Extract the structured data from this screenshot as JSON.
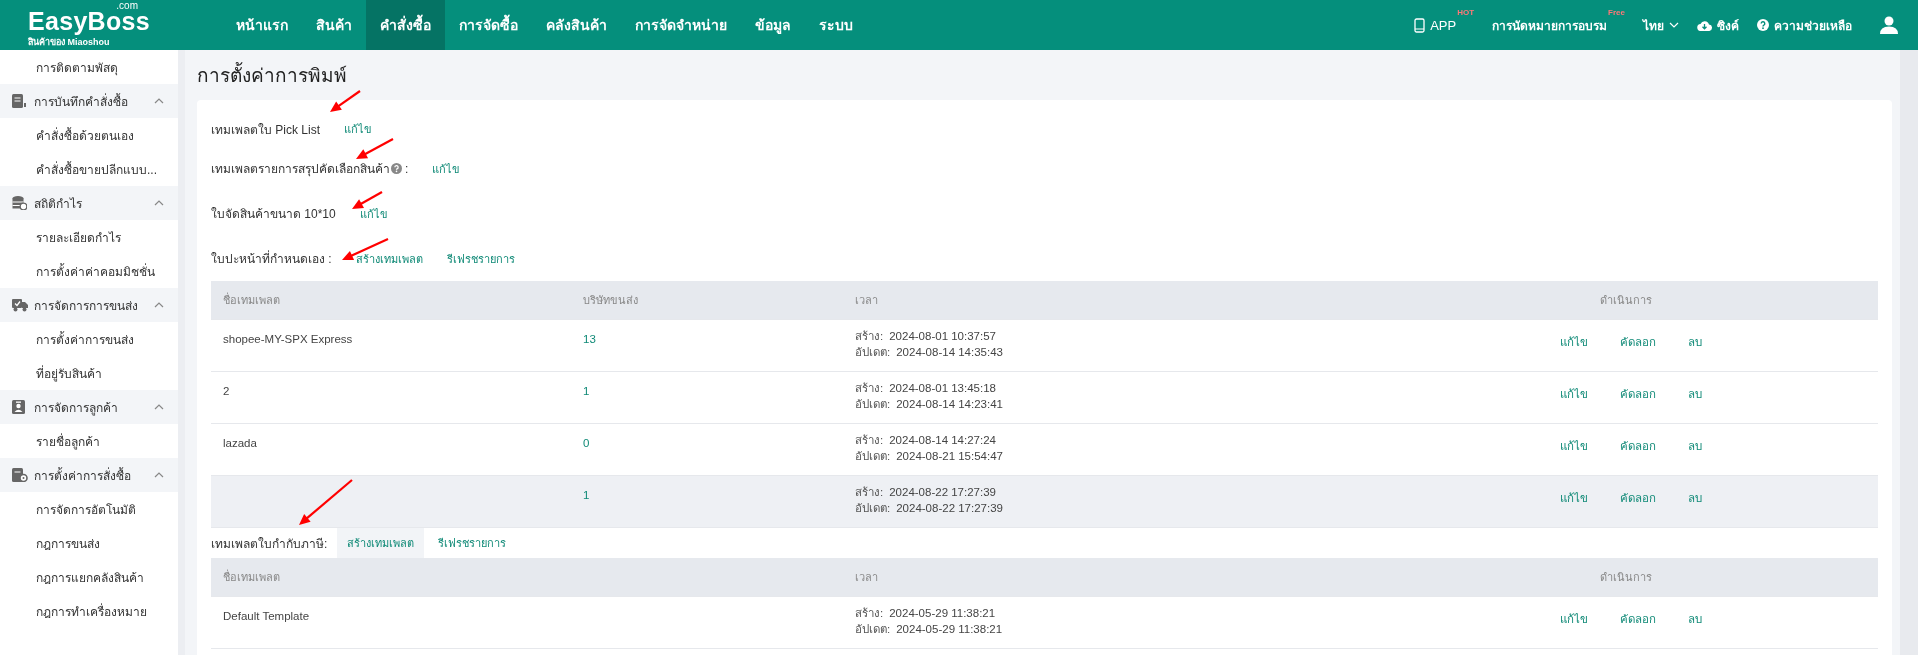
{
  "header": {
    "logo": {
      "name": "EasyBoss",
      "domain": ".com",
      "tagline": "สินค้าของ Miaoshou"
    },
    "nav": [
      {
        "label": "หน้าแรก",
        "selected": false
      },
      {
        "label": "สินค้า",
        "selected": false
      },
      {
        "label": "คำสั่งซื้อ",
        "selected": true
      },
      {
        "label": "การจัดซื้อ",
        "selected": false
      },
      {
        "label": "คลังสินค้า",
        "selected": false
      },
      {
        "label": "การจัดจำหน่าย",
        "selected": false
      },
      {
        "label": "ข้อมูล",
        "selected": false
      },
      {
        "label": "ระบบ",
        "selected": false
      }
    ],
    "app": {
      "label": "APP",
      "badge": "HOT"
    },
    "training": {
      "label": "การนัดหมายการอบรม",
      "badge": "Free"
    },
    "language": "ไทย",
    "sync": "ซิงค์",
    "help": "ความช่วยเหลือ"
  },
  "sidebar": {
    "items": [
      {
        "label": "การติดตามพัสดุ"
      }
    ],
    "groups": [
      {
        "label": "การบันทึกคำสั่งซื้อ",
        "expanded": true,
        "children": [
          {
            "label": "คำสั่งซื้อด้วยตนเอง"
          },
          {
            "label": "คำสั่งซื้อขายปลีกแบบ..."
          }
        ]
      },
      {
        "label": "สถิติกำไร",
        "expanded": true,
        "children": [
          {
            "label": "รายละเอียดกำไร"
          },
          {
            "label": "การตั้งค่าค่าคอมมิชชั่น"
          }
        ]
      },
      {
        "label": "การจัดการการขนส่ง",
        "expanded": true,
        "children": [
          {
            "label": "การตั้งค่าการขนส่ง"
          },
          {
            "label": "ที่อยู่รับสินค้า"
          }
        ]
      },
      {
        "label": "การจัดการลูกค้า",
        "expanded": true,
        "children": [
          {
            "label": "รายชื่อลูกค้า"
          }
        ]
      },
      {
        "label": "การตั้งค่าการสั่งซื้อ",
        "expanded": true,
        "children": [
          {
            "label": "การจัดการอัตโนมัติ"
          },
          {
            "label": "กฎการขนส่ง"
          },
          {
            "label": "กฎการแยกคลังสินค้า"
          },
          {
            "label": "กฎการทำเครื่องหมาย"
          }
        ]
      }
    ]
  },
  "page_title": "การตั้งค่าการพิมพ์",
  "templates": [
    {
      "label": "เทมเพลตใบ Pick List",
      "has_help": false,
      "actions": [
        {
          "label": "แก้ไข",
          "highlighted": false
        }
      ]
    },
    {
      "label": "เทมเพลตรายการสรุปคัดเลือกสินค้า",
      "has_help": true,
      "suffix": ":",
      "actions": [
        {
          "label": "แก้ไข",
          "highlighted": false
        }
      ]
    },
    {
      "label": "ใบจัดสินค้าขนาด 10*10",
      "has_help": false,
      "actions": [
        {
          "label": "แก้ไข",
          "highlighted": false
        }
      ]
    },
    {
      "label": "ใบปะหน้าที่กำหนดเอง :",
      "has_help": false,
      "actions": [
        {
          "label": "สร้างเทมเพลต",
          "highlighted": false
        },
        {
          "label": "รีเฟรชรายการ",
          "highlighted": false
        }
      ]
    }
  ],
  "custom_table": {
    "columns": [
      "ชื่อเทมเพลต",
      "บริษัทขนส่ง",
      "เวลา",
      "ดำเนินการ"
    ],
    "rows": [
      {
        "name": "shopee-MY-SPX Express",
        "carriers": "13",
        "created_label": "สร้าง:",
        "created": "2024-08-01 10:37:57",
        "updated_label": "อัปเดต:",
        "updated": "2024-08-14 14:35:43",
        "actions": [
          "แก้ไข",
          "คัดลอก",
          "ลบ"
        ],
        "highlighted": false
      },
      {
        "name": "2",
        "carriers": "1",
        "created_label": "สร้าง:",
        "created": "2024-08-01 13:45:18",
        "updated_label": "อัปเดต:",
        "updated": "2024-08-14 14:23:41",
        "actions": [
          "แก้ไข",
          "คัดลอก",
          "ลบ"
        ],
        "highlighted": false
      },
      {
        "name": "lazada",
        "carriers": "0",
        "created_label": "สร้าง:",
        "created": "2024-08-14 14:27:24",
        "updated_label": "อัปเดต:",
        "updated": "2024-08-21 15:54:47",
        "actions": [
          "แก้ไข",
          "คัดลอก",
          "ลบ"
        ],
        "highlighted": false
      },
      {
        "carriers": "1",
        "created_label": "สร้าง:",
        "created": "2024-08-22 17:27:39",
        "updated_label": "อัปเดต:",
        "updated": "2024-08-22 17:27:39",
        "actions": [
          "แก้ไข",
          "คัดลอก",
          "ลบ"
        ],
        "highlighted": true
      }
    ]
  },
  "tax_section": {
    "label": "เทมเพลตใบกำกับภาษี:",
    "actions": [
      {
        "label": "สร้างเทมเพลต",
        "highlighted": true
      },
      {
        "label": "รีเฟรชรายการ",
        "highlighted": false
      }
    ]
  },
  "tax_table": {
    "columns": [
      "ชื่อเทมเพลต",
      "เวลา",
      "ดำเนินการ"
    ],
    "rows": [
      {
        "name": "Default Template",
        "created_label": "สร้าง:",
        "created": "2024-05-29 11:38:21",
        "updated_label": "อัปเดต:",
        "updated": "2024-05-29 11:38:21",
        "actions": [
          "แก้ไข",
          "คัดลอก",
          "ลบ"
        ],
        "highlighted": false
      }
    ]
  }
}
